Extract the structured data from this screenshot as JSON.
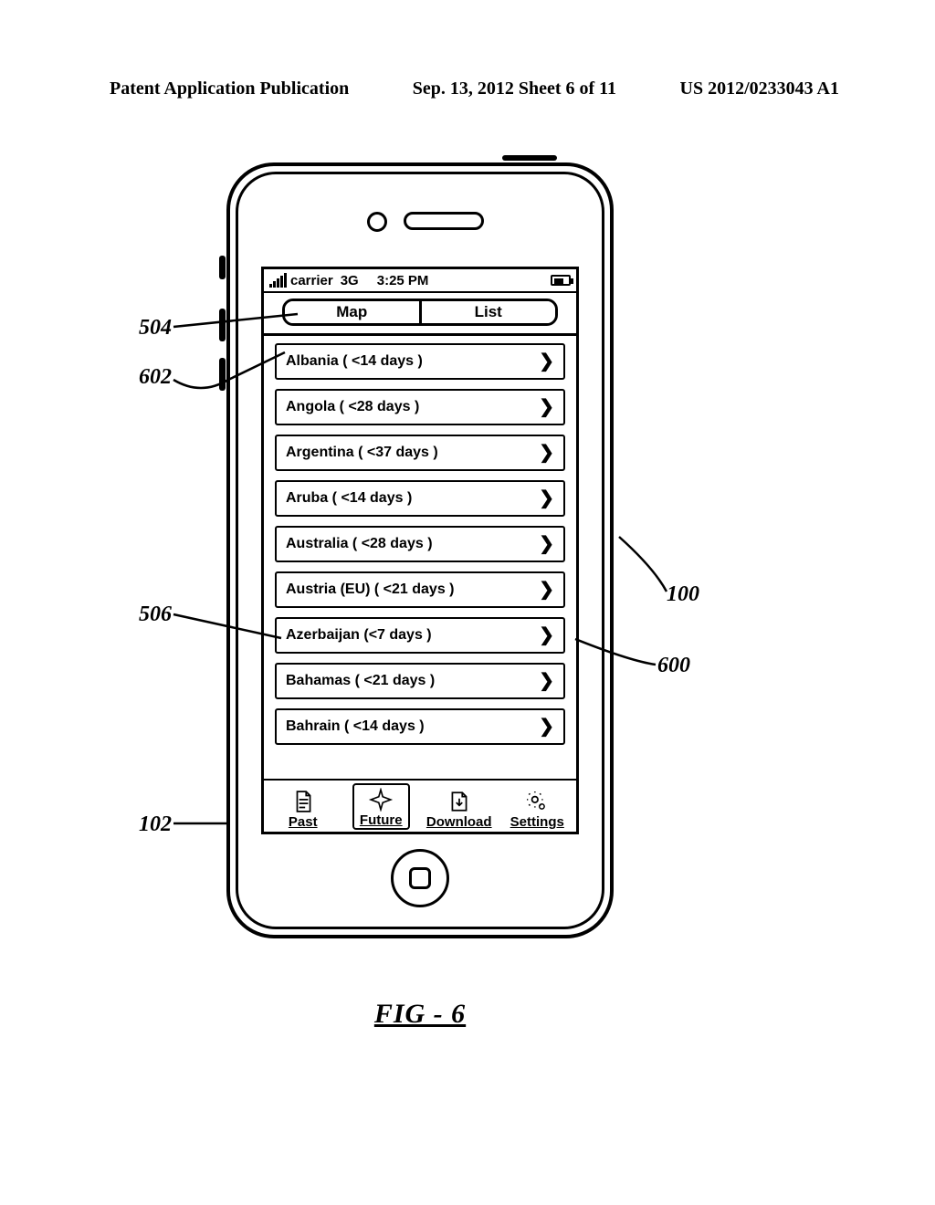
{
  "header": {
    "left": "Patent Application Publication",
    "center": "Sep. 13, 2012  Sheet 6 of 11",
    "right": "US 2012/0233043 A1"
  },
  "statusbar": {
    "carrier": "carrier",
    "network": "3G",
    "time": "3:25 PM"
  },
  "segmented": {
    "map": "Map",
    "list": "List"
  },
  "list_items": [
    {
      "label": "Albania ( <14 days )"
    },
    {
      "label": "Angola ( <28 days )"
    },
    {
      "label": "Argentina ( <37 days )"
    },
    {
      "label": "Aruba ( <14 days )"
    },
    {
      "label": "Australia ( <28 days )"
    },
    {
      "label": "Austria  (EU)  ( <21 days )"
    },
    {
      "label": "Azerbaijan  (<7 days )"
    },
    {
      "label": "Bahamas ( <21 days )"
    },
    {
      "label": "Bahrain ( <14 days )"
    }
  ],
  "tabs": {
    "past": "Past",
    "future": "Future",
    "download": "Download",
    "settings": "Settings"
  },
  "refs": {
    "r504": "504",
    "r602": "602",
    "r506": "506",
    "r102": "102",
    "r100": "100",
    "r600": "600"
  },
  "figure_caption": "FIG - 6"
}
